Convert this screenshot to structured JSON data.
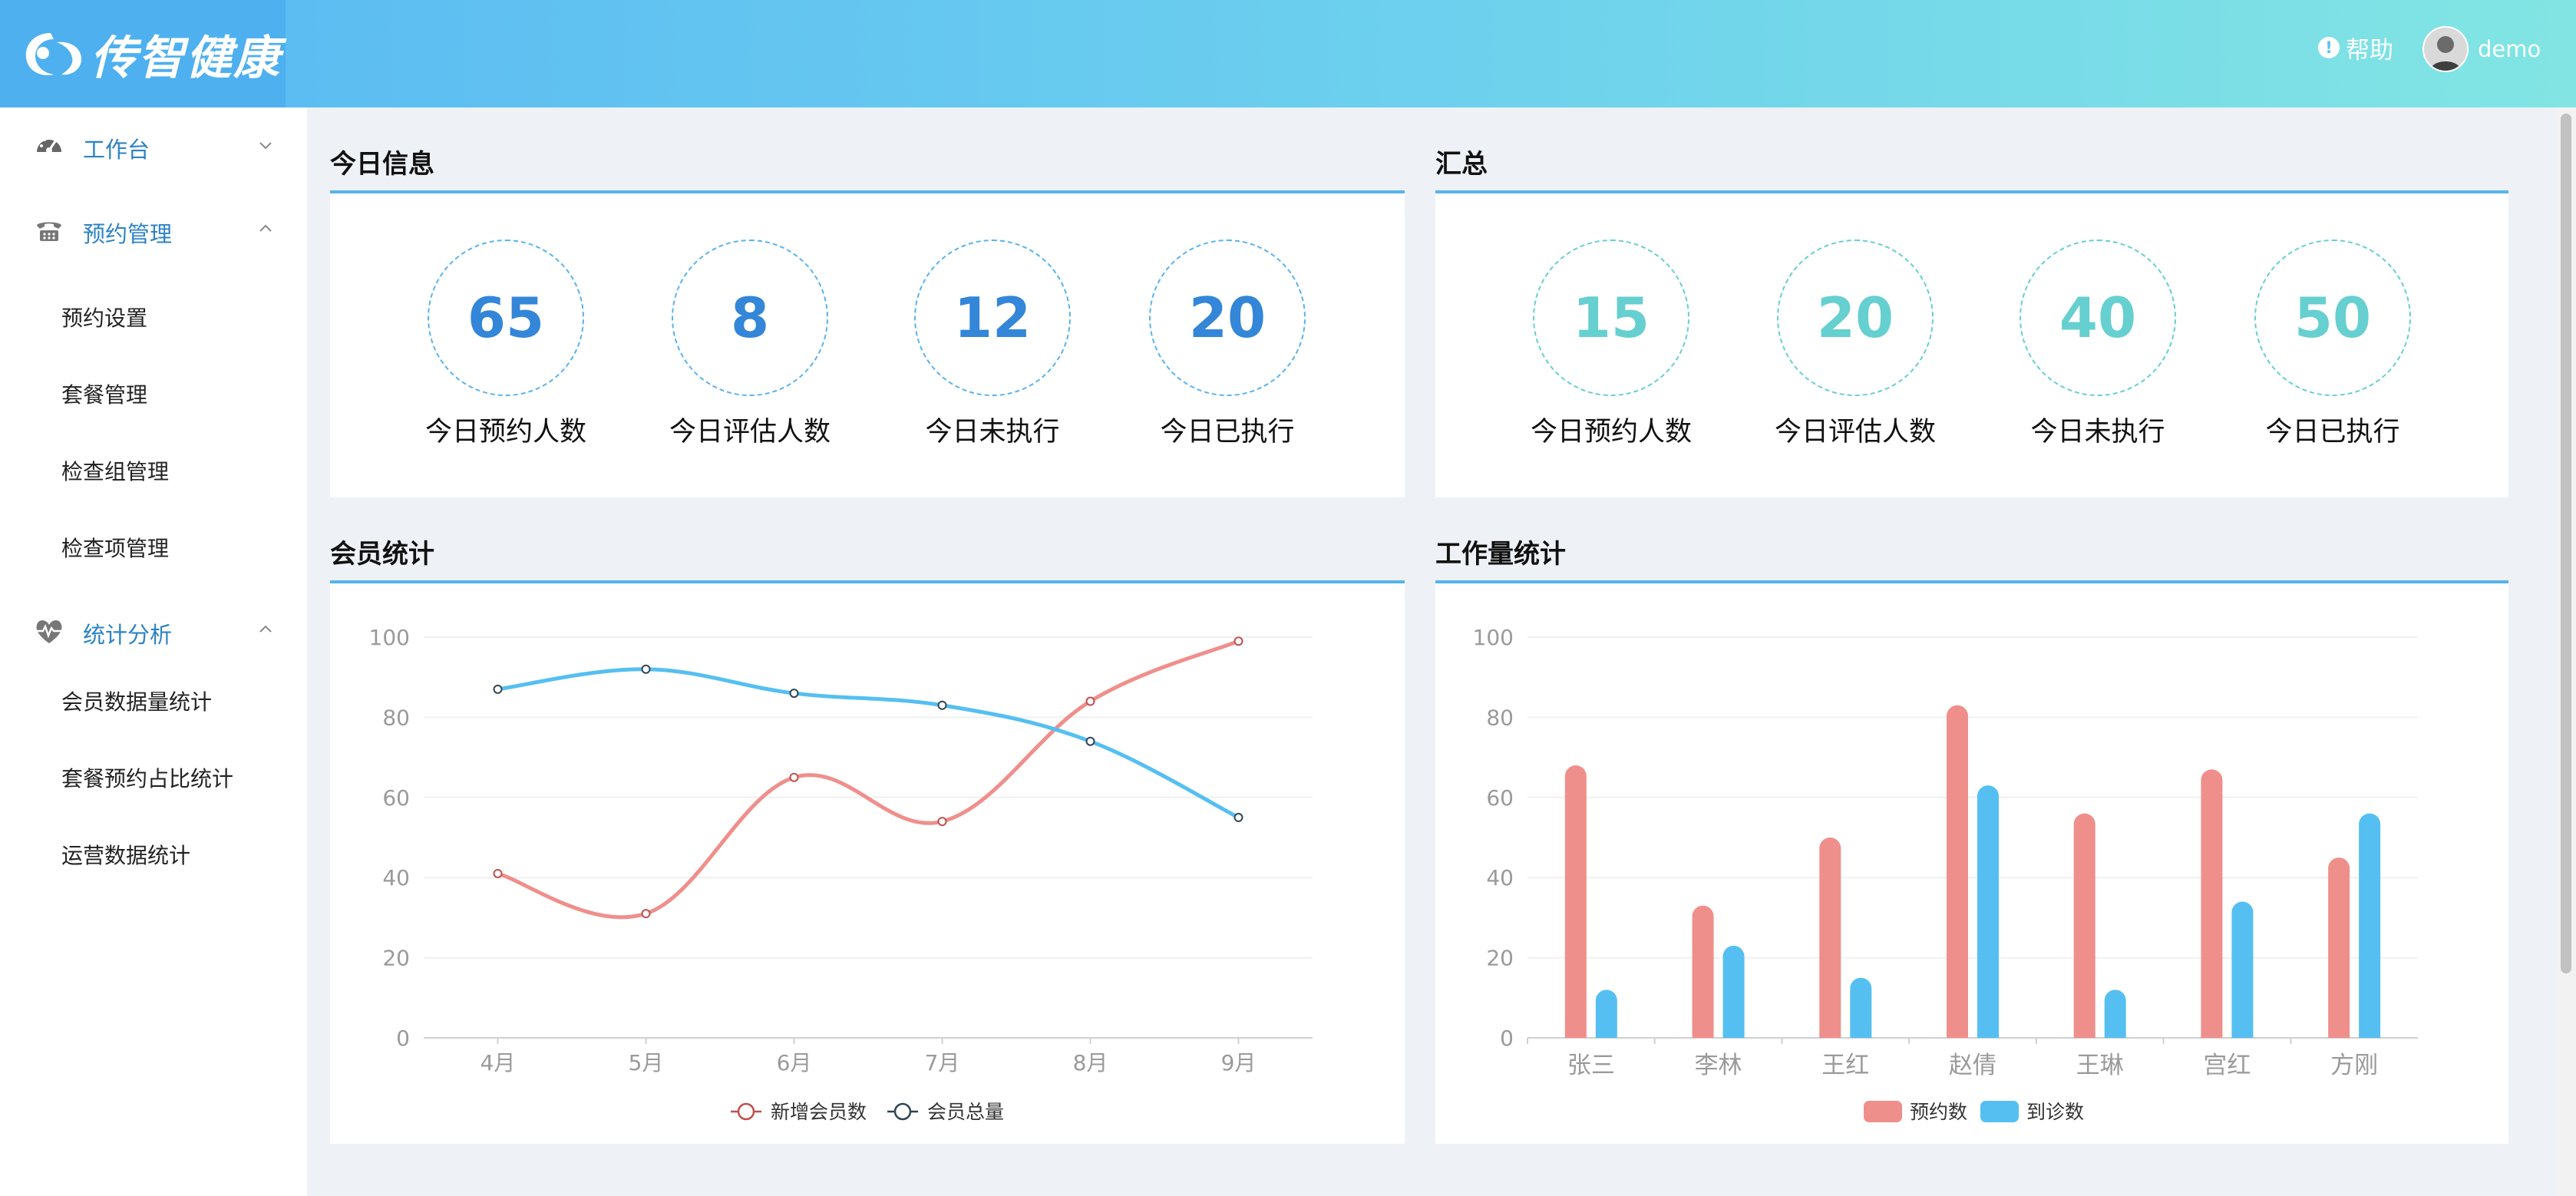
{
  "header": {
    "logo_text": "传智健康",
    "help_label": "帮助",
    "user_name": "demo"
  },
  "sidebar": {
    "groups": [
      {
        "label": "工作台",
        "icon": "dashboard-icon",
        "expanded": false
      },
      {
        "label": "预约管理",
        "icon": "phone-icon",
        "expanded": true,
        "items": [
          "预约设置",
          "套餐管理",
          "检查组管理",
          "检查项管理"
        ]
      },
      {
        "label": "统计分析",
        "icon": "heartbeat-icon",
        "expanded": true,
        "items": [
          "会员数据量统计",
          "套餐预约占比统计",
          "运营数据统计"
        ]
      }
    ]
  },
  "today": {
    "title": "今日信息",
    "stats": [
      {
        "value": "65",
        "label": "今日预约人数"
      },
      {
        "value": "8",
        "label": "今日评估人数"
      },
      {
        "value": "12",
        "label": "今日未执行"
      },
      {
        "value": "20",
        "label": "今日已执行"
      }
    ]
  },
  "summary": {
    "title": "汇总",
    "stats": [
      {
        "value": "15",
        "label": "今日预约人数"
      },
      {
        "value": "20",
        "label": "今日评估人数"
      },
      {
        "value": "40",
        "label": "今日未执行"
      },
      {
        "value": "50",
        "label": "今日已执行"
      }
    ]
  },
  "member_title": "会员统计",
  "workload_title": "工作量统计",
  "colors": {
    "red": "#ef8f8b",
    "blue": "#55bff2",
    "accent": "#57b3ef"
  },
  "chart_data": [
    {
      "type": "line",
      "title": "",
      "x": [
        "4月",
        "5月",
        "6月",
        "7月",
        "8月",
        "9月"
      ],
      "series": [
        {
          "name": "新增会员数",
          "values": [
            41,
            31,
            65,
            54,
            84,
            99
          ]
        },
        {
          "name": "会员总量",
          "values": [
            87,
            92,
            86,
            83,
            74,
            55
          ]
        }
      ],
      "ylim": [
        0,
        100
      ],
      "yticks": [
        0,
        20,
        40,
        60,
        80,
        100
      ],
      "legend": "bottom-center",
      "grid": true
    },
    {
      "type": "bar",
      "title": "",
      "categories": [
        "张三",
        "李林",
        "王红",
        "赵倩",
        "王琳",
        "宫红",
        "方刚"
      ],
      "series": [
        {
          "name": "预约数",
          "values": [
            68,
            33,
            50,
            83,
            56,
            67,
            45
          ]
        },
        {
          "name": "到诊数",
          "values": [
            12,
            23,
            15,
            63,
            12,
            34,
            56
          ]
        }
      ],
      "ylim": [
        0,
        100
      ],
      "yticks": [
        0,
        20,
        40,
        60,
        80,
        100
      ],
      "legend": "bottom-center",
      "grid": true
    }
  ]
}
